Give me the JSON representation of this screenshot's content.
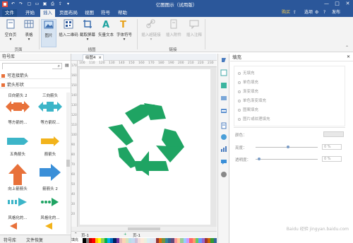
{
  "titlebar": {
    "title": "亿图图示（试用版）",
    "min": "—",
    "max": "□",
    "close": "✕"
  },
  "menu": {
    "file": "文件",
    "tabs": [
      "开始",
      "插入",
      "页面布局",
      "视图",
      "符号",
      "帮助"
    ],
    "buy": "购买",
    "publish": "发布",
    "options": "选项",
    "help_icon": "?"
  },
  "ribbon": {
    "buttons": [
      {
        "label": "空白页",
        "name": "blank-page"
      },
      {
        "label": "表格",
        "name": "table"
      },
      {
        "label": "图片",
        "name": "picture"
      },
      {
        "label": "插入二维码",
        "name": "insert-qrcode"
      },
      {
        "label": "截取屏幕",
        "name": "screenshot"
      },
      {
        "label": "矢量文本",
        "name": "vector-text"
      },
      {
        "label": "字体符号",
        "name": "font-symbol"
      },
      {
        "label": "插入超链接",
        "name": "insert-hyperlink"
      },
      {
        "label": "插入附件",
        "name": "insert-attachment"
      },
      {
        "label": "插入注释",
        "name": "insert-comment"
      }
    ],
    "groups": [
      "页面",
      "插图",
      "链接"
    ]
  },
  "library": {
    "title": "符号库",
    "search_placeholder": "",
    "categories": [
      "可连接箭头",
      "箭头形状"
    ],
    "shapes": [
      "日向箭头 2",
      "三向箭头",
      "等方箭的...",
      "等方箭叹...",
      "五角箭头",
      "箭箭头",
      "向上箭箭头",
      "箭箭头 2",
      "风格化的...",
      "风格化的..."
    ],
    "tabs": [
      "符号库",
      "文件恢复"
    ]
  },
  "document": {
    "tab": "绘图4",
    "ruler_h": [
      "100",
      "110",
      "120",
      "130",
      "140",
      "150",
      "160",
      "170",
      "180",
      "190",
      "200",
      "210",
      "220",
      "230"
    ],
    "ruler_v": [
      "170",
      "160",
      "150",
      "140",
      "130",
      "120",
      "110",
      "100",
      "90",
      "80",
      "70",
      "60",
      "50",
      "40",
      "30",
      "20"
    ],
    "page_tab": "页-1",
    "page_tab2": "页-1",
    "palette_label": "填充"
  },
  "fill": {
    "title": "填充",
    "options": [
      "无填充",
      "单色填充",
      "渐变填充",
      "单色渐变填充",
      "图案填充",
      "图片或纹理填充"
    ],
    "color_label": "颜色：",
    "brightness_label": "亮度：",
    "transparency_label": "透明度：",
    "brightness_value": "0 %",
    "transparency_value": "0 %"
  },
  "colors": {
    "brand": "#2b579a",
    "recycle": "#1fa463",
    "arrow_orange": "#e8713a",
    "arrow_teal": "#3cb5c8",
    "arrow_yellow": "#f2b31b"
  },
  "watermark": "Baidu 经验 jingyan.baidu.com"
}
